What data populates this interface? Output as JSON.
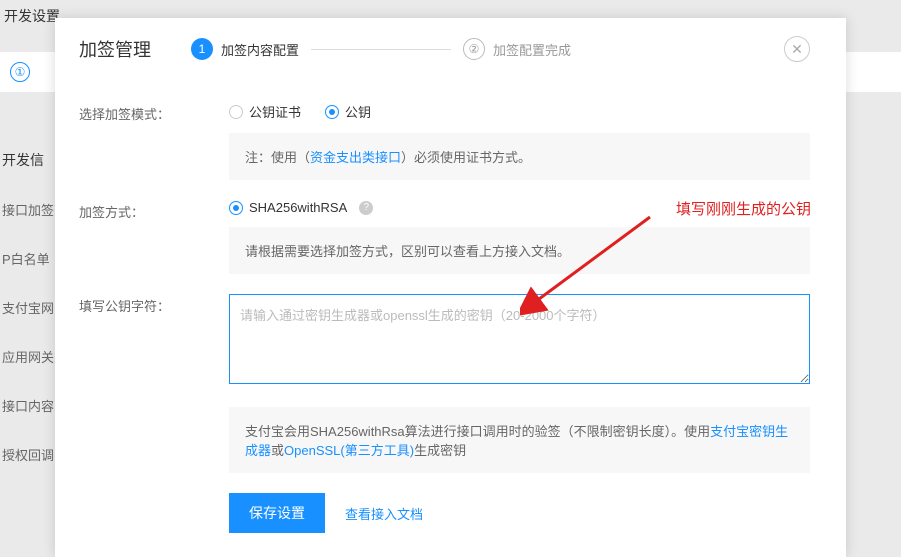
{
  "bg": {
    "title": "开发设置",
    "tab_number": "①",
    "side_heading": "开发信",
    "items": [
      "接口加签",
      "P白名单",
      "支付宝网",
      "应用网关",
      "接口内容",
      "授权回调"
    ]
  },
  "modal": {
    "title": "加签管理",
    "step1_num": "1",
    "step1_label": "加签内容配置",
    "step2_num": "②",
    "step2_label": "加签配置完成",
    "close": "✕"
  },
  "form": {
    "mode_label": "选择加签模式：",
    "mode_opt1": "公钥证书",
    "mode_opt2": "公钥",
    "mode_note_prefix": "注：使用（",
    "mode_note_link": "资金支出类接口",
    "mode_note_suffix": "）必须使用证书方式。",
    "method_label": "加签方式：",
    "method_opt1": "SHA256withRSA",
    "help_icon": "?",
    "method_note": "请根据需要选择加签方式，区别可以查看上方接入文档。",
    "key_label": "填写公钥字符：",
    "key_placeholder": "请输入通过密钥生成器或openssl生成的密钥（20-2000个字符）",
    "key_note_prefix": "支付宝会用SHA256withRsa算法进行接口调用时的验签（不限制密钥长度）。使用",
    "key_note_link1": "支付宝密钥生成器",
    "key_note_mid": "或",
    "key_note_link2": "OpenSSL(第三方工具)",
    "key_note_suffix": "生成密钥",
    "save_btn": "保存设置",
    "doc_link": "查看接入文档"
  },
  "annotation": {
    "text": "填写刚刚生成的公钥"
  }
}
